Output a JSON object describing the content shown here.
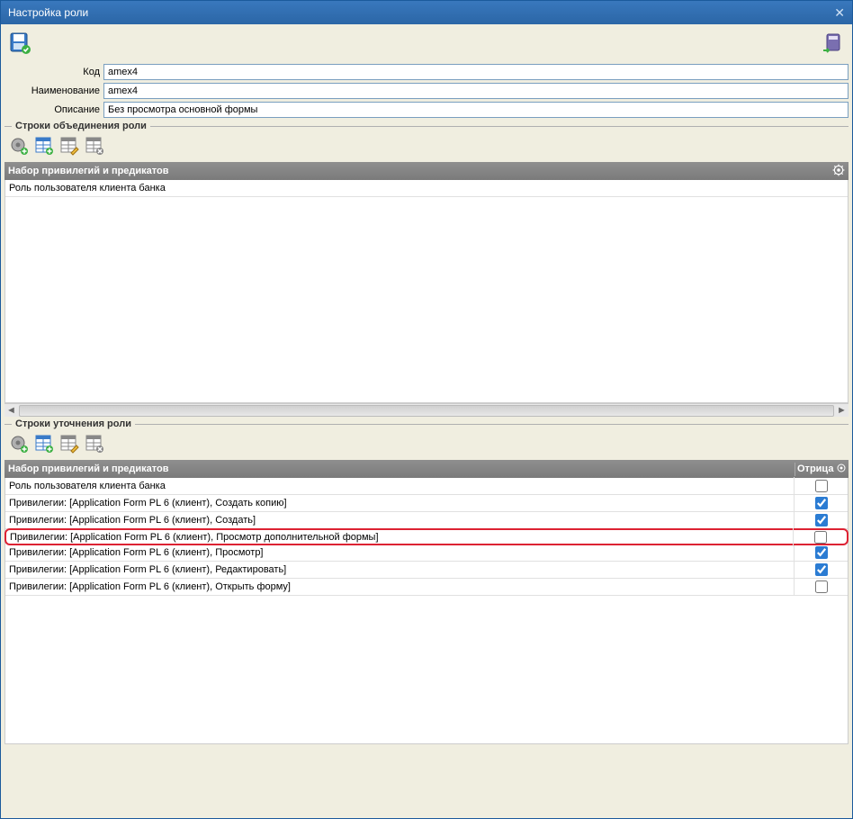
{
  "window": {
    "title": "Настройка роли"
  },
  "fields": {
    "code_label": "Код",
    "code_value": "amex4",
    "name_label": "Наименование",
    "name_value": "amex4",
    "desc_label": "Описание",
    "desc_value": "Без просмотра основной формы"
  },
  "sections": {
    "union_label": "Строки объединения роли",
    "refine_label": "Строки уточнения роли",
    "header_label": "Набор привилегий и предикатов"
  },
  "union_rows": {
    "row0": "Роль пользователя клиента банка"
  },
  "grid": {
    "col_neg": "Отрица",
    "rows": {
      "r0": {
        "text": "Роль пользователя клиента банка"
      },
      "r1": {
        "text": "Привилегии: [Application Form PL 6 (клиент), Создать копию]"
      },
      "r2": {
        "text": "Привилегии: [Application Form PL 6 (клиент), Создать]"
      },
      "r3": {
        "text": "Привилегии: [Application Form PL 6 (клиент), Просмотр дополнительной формы]"
      },
      "r4": {
        "text": "Привилегии: [Application Form PL 6 (клиент), Просмотр]"
      },
      "r5": {
        "text": "Привилегии: [Application Form PL 6 (клиент), Редактировать]"
      },
      "r6": {
        "text": "Привилегии: [Application Form PL 6 (клиент), Открыть форму]"
      }
    }
  }
}
